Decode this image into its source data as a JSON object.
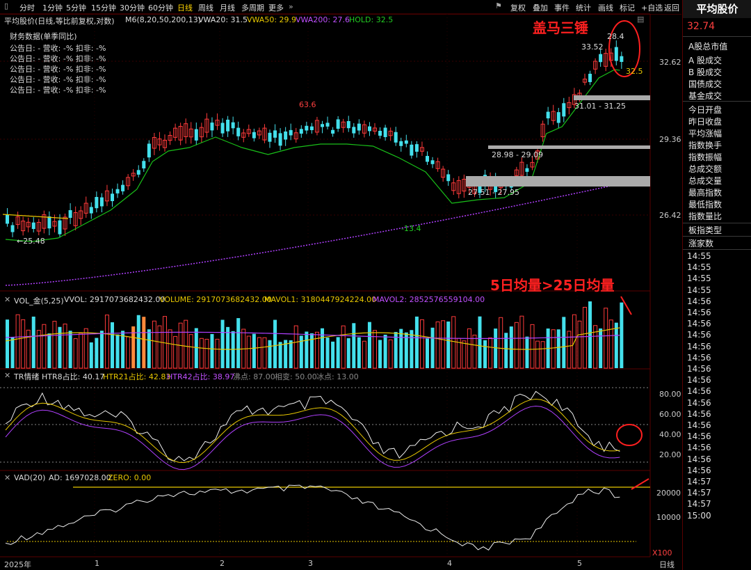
{
  "toolbar": {
    "left_tabs": [
      "分时",
      "1分钟",
      "5分钟",
      "15分钟",
      "30分钟",
      "60分钟",
      "日线",
      "周线",
      "月线",
      "多周期",
      "更多"
    ],
    "active_tab": "日线",
    "right_tools": [
      "复权",
      "叠加",
      "事件",
      "统计",
      "画线",
      "标记",
      "+自选",
      "返回"
    ]
  },
  "main": {
    "header": {
      "title": "平均股价(日线,等比前复权,对数)",
      "ma_label": "M6(8,20,50,200,13)",
      "vwa20": "VWA20: 31.5",
      "vwa50": "VWA50: 29.9",
      "vwa200": "VWA200: 27.6",
      "hold": "HOLD: 32.5"
    },
    "financial": {
      "heading": "财务数据(单季同比)",
      "rows": [
        "公告日: -   营收: -%   扣非: -%",
        "公告日: -   营收: -%   扣非: -%",
        "公告日: -   营收: -%   扣非: -%",
        "公告日: -   营收: -%   扣非: -%",
        "公告日: -   营收: -%   扣非: -%"
      ]
    },
    "y_labels": [
      "32.62",
      "29.36",
      "26.42"
    ],
    "annotations": {
      "title_red": "盖马三锤",
      "hi_label": "28.4",
      "price_label": "33.52",
      "hold_label": "32.5",
      "peak_label": "63.6",
      "low_label": "-13.4",
      "start_label": "←25.48",
      "zone1": "31.01 - 31.25",
      "zone2": "28.98 - 29.09",
      "zone3": "27.51 - 27.95"
    }
  },
  "volume": {
    "header": {
      "name": "VOL_金(5,25)",
      "vvol": "VVOL: 2917073682432.00",
      "volume": "VOLUME: 2917073682432.00",
      "mavol1": "MAVOL1: 3180447924224.00",
      "mavol2": "MAVOL2: 2852576559104.00"
    },
    "annotation": "5日均量>25日均量"
  },
  "tr": {
    "header": {
      "name": "TR情绪",
      "htr8": "HTR8占比: 40.17",
      "htr21": "HTR21占比: 42.83",
      "htr42": "HTR42占比: 38.97",
      "boil": "沸点: 87.00",
      "neutral": "相变: 50.00",
      "freeze": "冰点: 13.00"
    },
    "y_labels": [
      "80.00",
      "60.00",
      "40.00",
      "20.00"
    ]
  },
  "vad": {
    "header": {
      "name": "VAD(20)",
      "ad": "AD: 1697028.00",
      "zero": "ZERO: 0.00"
    },
    "y_labels": [
      "20000",
      "10000"
    ],
    "unit": "X100"
  },
  "xaxis": {
    "labels": [
      "2025年",
      "1",
      "2",
      "3",
      "4",
      "5"
    ],
    "period": "日线"
  },
  "right_panel": {
    "title": "平均股价",
    "value": "32.74",
    "items": [
      "A股总市值",
      "A 股成交",
      "B 股成交",
      "国债成交",
      "基金成交",
      "今日开盘",
      "昨日收盘",
      "平均涨幅",
      "指数换手",
      "指数振幅",
      "总成交额",
      "总成交量",
      "最高指数",
      "最低指数",
      "指数量比",
      "板指类型",
      "涨家数"
    ],
    "times": [
      "14:55",
      "14:55",
      "14:55",
      "14:55",
      "14:56",
      "14:56",
      "14:56",
      "14:56",
      "14:56",
      "14:56",
      "14:56",
      "14:56",
      "14:56",
      "14:56",
      "14:56",
      "14:56",
      "14:56",
      "14:56",
      "14:56",
      "14:56",
      "14:57",
      "14:57",
      "14:57",
      "15:00"
    ]
  },
  "colors": {
    "up": "#ff3b3b",
    "down": "#44e0ec",
    "ma_green": "#19c019",
    "vwap_purple": "#b040ff",
    "yellow": "#e8c800",
    "orange": "#ff8a3c",
    "annot_red": "#ff2020"
  }
}
